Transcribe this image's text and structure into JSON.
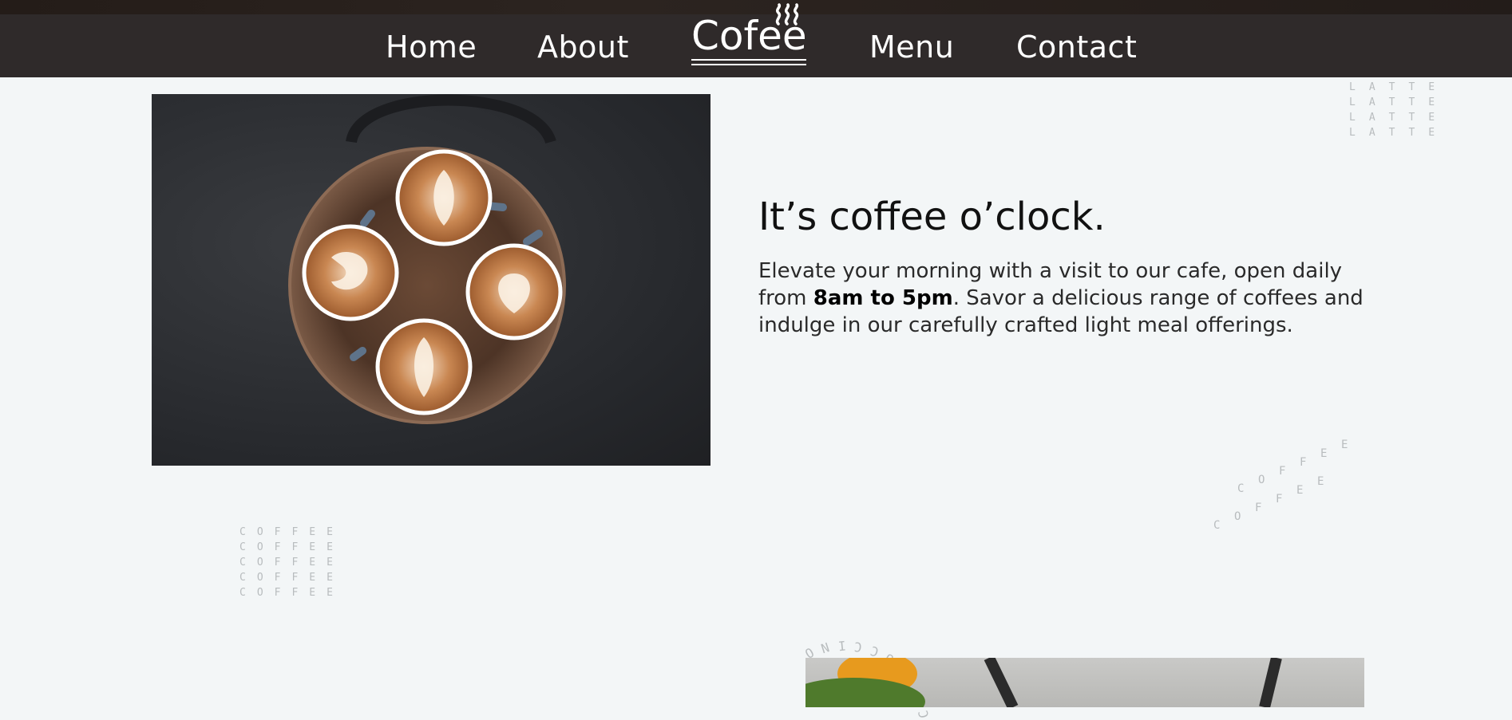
{
  "nav": {
    "items": [
      "Home",
      "About",
      "Menu",
      "Contact"
    ],
    "logo": "Cofee"
  },
  "hero": {
    "headline": "It’s coffee o’clock.",
    "body_before": "Elevate your morning with a visit to our cafe, open daily from ",
    "body_hours": "8am to 5pm",
    "body_after": ". Savor a delicious range of coffees and indulge in our carefully crafted light meal offerings."
  },
  "decor": {
    "latte": "LATTE",
    "coffee": "COFFEE",
    "cappuccino": "CAPPUCCINO"
  },
  "colors": {
    "nav_bg": "#2f2a2a",
    "page_bg": "#f3f6f7",
    "text": "#111111"
  }
}
